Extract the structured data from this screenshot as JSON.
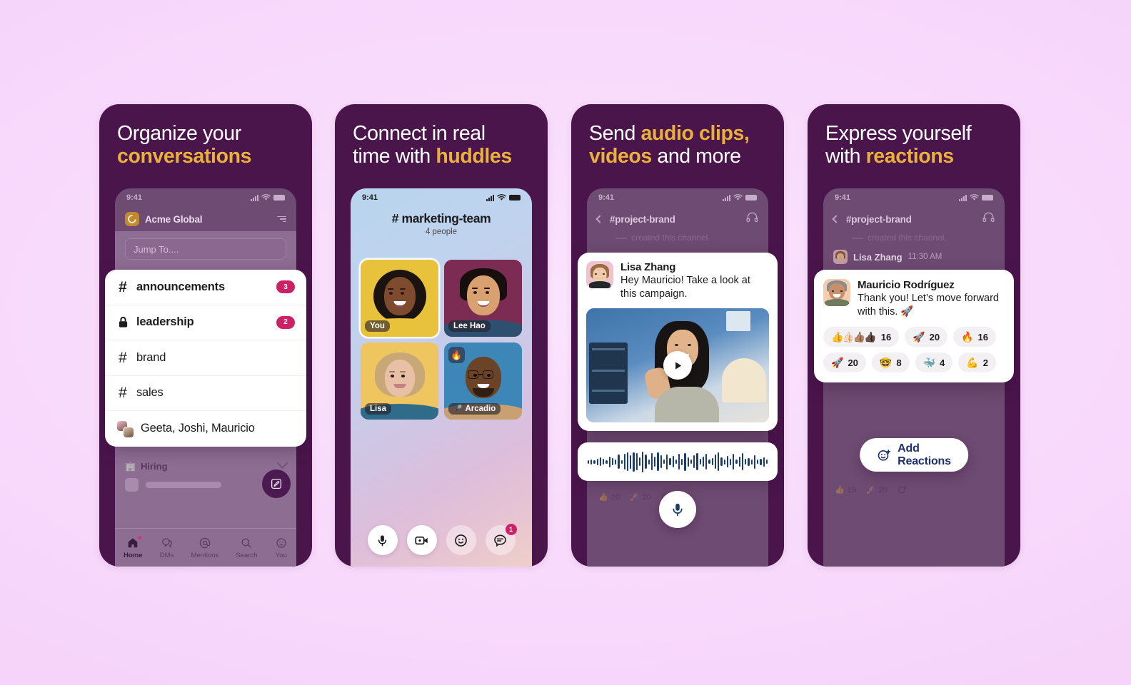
{
  "background": {
    "color": "#F7D6FB"
  },
  "brand": {
    "purple": "#4A154B",
    "gold": "#E9B13C",
    "pink_badge": "#CA2265",
    "screen_dim": "#6E4B72"
  },
  "panels": [
    {
      "id": "organize",
      "headline": {
        "line1_plain": "Organize your",
        "line2_highlight": "conversations"
      },
      "status_bar": {
        "time": "9:41"
      },
      "workspace": {
        "name": "Acme Global",
        "logo_icon": "acme-logo-icon",
        "filter_icon": "filter-icon"
      },
      "search": {
        "placeholder": "Jump To...."
      },
      "channels": [
        {
          "icon": "hash-icon",
          "name": "announcements",
          "unread": "3",
          "bold": true
        },
        {
          "icon": "lock-icon",
          "name": "leadership",
          "unread": "2",
          "bold": true
        },
        {
          "icon": "hash-icon",
          "name": "brand",
          "unread": "",
          "bold": false
        },
        {
          "icon": "hash-icon",
          "name": "sales",
          "unread": "",
          "bold": false
        },
        {
          "icon": "dm-avatars-icon",
          "name": "Geeta, Joshi, Mauricio",
          "unread": "",
          "bold": false
        }
      ],
      "section": {
        "emoji": "🏢",
        "label": "Hiring"
      },
      "compose_button": "compose-icon",
      "tabs": [
        {
          "label": "Home",
          "icon": "home-icon",
          "active": true,
          "dot": true
        },
        {
          "label": "DMs",
          "icon": "dms-icon",
          "active": false,
          "dot": false
        },
        {
          "label": "Mentions",
          "icon": "at-icon",
          "active": false,
          "dot": false
        },
        {
          "label": "Search",
          "icon": "search-icon",
          "active": false,
          "dot": false
        },
        {
          "label": "You",
          "icon": "you-icon",
          "active": false,
          "dot": false
        }
      ]
    },
    {
      "id": "huddles",
      "headline": {
        "line1_plain": "Connect in real",
        "line2_plain": "time with ",
        "line2_highlight": "huddles"
      },
      "status_bar": {
        "time": "9:41"
      },
      "huddle": {
        "channel": "# marketing-team",
        "members_count": "4 people",
        "tiles": [
          {
            "name": "You",
            "self": true,
            "reaction": ""
          },
          {
            "name": "Lee Hao",
            "self": false,
            "reaction": ""
          },
          {
            "name": "Lisa",
            "self": false,
            "reaction": ""
          },
          {
            "name": "Arcadio",
            "self": false,
            "reaction": "🔥",
            "name_emoji": "🎤"
          }
        ],
        "controls": [
          {
            "icon": "microphone-icon",
            "style": "solid",
            "badge": ""
          },
          {
            "icon": "video-camera-icon",
            "style": "solid",
            "badge": ""
          },
          {
            "icon": "emoji-smiley-icon",
            "style": "ghost",
            "badge": ""
          },
          {
            "icon": "chat-thread-icon",
            "style": "ghost",
            "badge": "1"
          }
        ]
      }
    },
    {
      "id": "clips",
      "headline": {
        "line1_plain": "Send ",
        "line1_highlight": "audio clips,",
        "line2_highlight": "videos",
        "line2_plain": " and more"
      },
      "status_bar": {
        "time": "9:41"
      },
      "channel": {
        "name": "#project-brand",
        "back_icon": "back-chevron-icon",
        "huddle_icon": "headphones-icon"
      },
      "created_line": "created this channel.",
      "message": {
        "author": "Lisa Zhang",
        "text": "Hey Mauricio! Take a look at this campaign.",
        "video_play_icon": "play-icon"
      },
      "audio_clip": {
        "waveform_icon": "waveform-icon"
      },
      "record_button": "microphone-icon",
      "ghost_reactions": [
        {
          "emoji": "👍",
          "count": "20"
        },
        {
          "emoji": "🚀",
          "count": "20"
        },
        {
          "emoji": "",
          "count": ""
        }
      ]
    },
    {
      "id": "reactions",
      "headline": {
        "line1_plain": "Express yourself",
        "line2_plain": "with ",
        "line2_highlight": "reactions"
      },
      "status_bar": {
        "time": "9:41"
      },
      "channel": {
        "name": "#project-brand",
        "back_icon": "back-chevron-icon",
        "huddle_icon": "headphones-icon"
      },
      "created_line": "created this channel.",
      "prev_message": {
        "author": "Lisa Zhang",
        "time": "11:30 AM"
      },
      "message": {
        "author": "Mauricio Rodríguez",
        "text": "Thank you! Let’s move forward with this. 🚀"
      },
      "reactions": [
        {
          "emojis": "👍👍🏻👍🏽👍🏿",
          "count": "16"
        },
        {
          "emojis": "🚀",
          "count": "20"
        },
        {
          "emojis": "🔥",
          "count": "16"
        },
        {
          "emojis": "🚀",
          "count": "20"
        },
        {
          "emojis": "🤓",
          "count": "8"
        },
        {
          "emojis": "🐳",
          "count": "4"
        },
        {
          "emojis": "💪",
          "count": "2"
        }
      ],
      "add_reactions_button": {
        "label": "Add Reactions",
        "icon": "add-reaction-icon"
      },
      "ghost_reactions": [
        {
          "emoji": "👍",
          "count": "15"
        },
        {
          "emoji": "🚀",
          "count": "20"
        }
      ]
    }
  ]
}
